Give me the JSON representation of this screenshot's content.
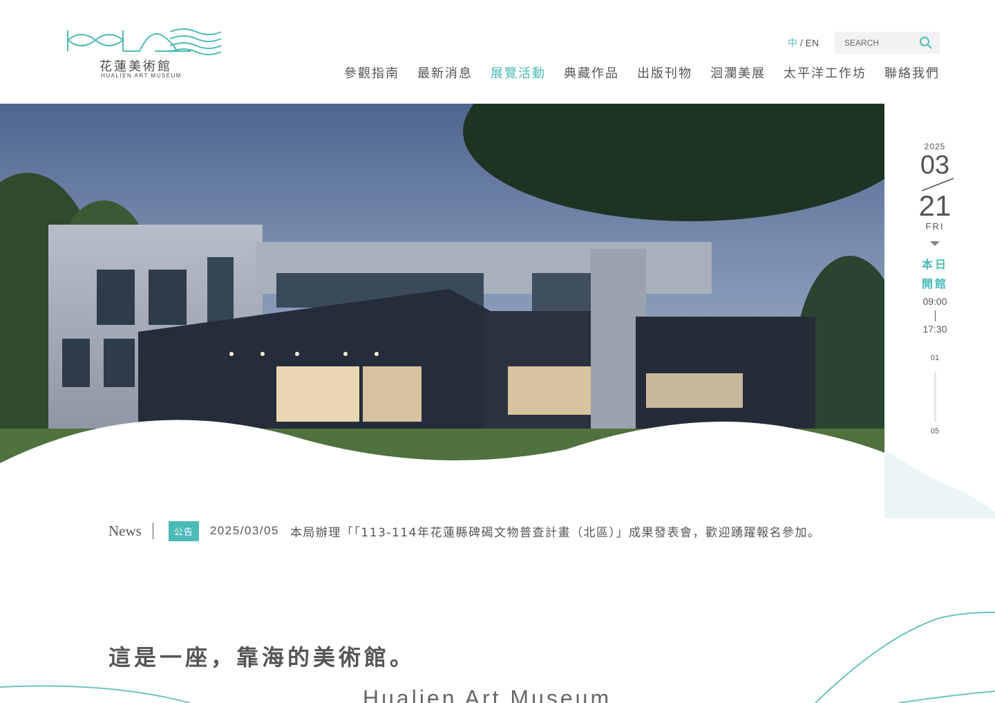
{
  "logo": {
    "name_cn": "花蓮美術館",
    "name_en": "HUALIEN ART MUSEUM"
  },
  "lang": {
    "zh": "中",
    "sep": "/",
    "en": "EN"
  },
  "search": {
    "placeholder": "SEARCH",
    "icon": "search-icon"
  },
  "nav": [
    {
      "label": "參觀指南"
    },
    {
      "label": "最新消息"
    },
    {
      "label": "展覽活動",
      "active": true
    },
    {
      "label": "典藏作品"
    },
    {
      "label": "出版刊物"
    },
    {
      "label": "洄瀾美展"
    },
    {
      "label": "太平洋工作坊"
    },
    {
      "label": "聯絡我們"
    }
  ],
  "side": {
    "year": "2025",
    "month": "03",
    "day": "21",
    "weekday": "FRI",
    "open_line1": "本日",
    "open_line2": "開館",
    "open_time": "09:00",
    "close_time": "17:30",
    "slide_current": "01",
    "slide_total": "05"
  },
  "news": {
    "label": "News",
    "tag": "公告",
    "date": "2025/03/05",
    "text": "本局辦理「「113-114年花蓮縣碑碣文物普查計畫（北區）」成果發表會，歡迎踴躍報名參加。"
  },
  "intro": {
    "tagline": "這是一座，靠海的美術館。",
    "subtitle": "Hualien Art Museum"
  },
  "colors": {
    "accent": "#4bbab7",
    "text": "#555555"
  }
}
